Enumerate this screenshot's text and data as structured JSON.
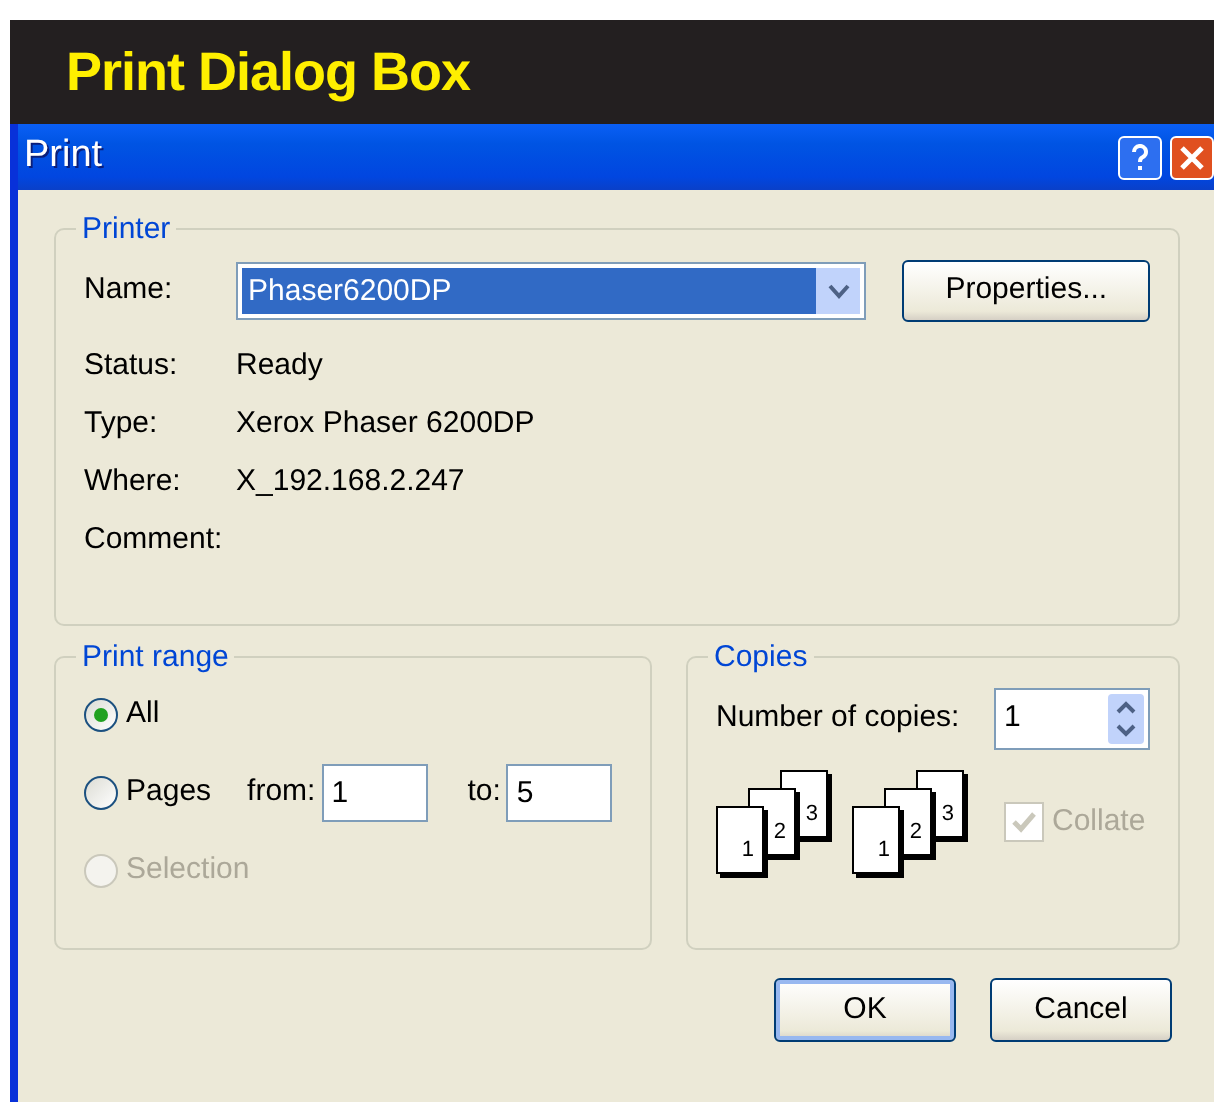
{
  "banner": {
    "title": "Print Dialog Box"
  },
  "window": {
    "title": "Print"
  },
  "printer": {
    "legend": "Printer",
    "name_label": "Name:",
    "name_value": "Phaser6200DP",
    "properties_button": "Properties...",
    "info": [
      {
        "label": "Status:",
        "value": "Ready"
      },
      {
        "label": "Type:",
        "value": "Xerox Phaser 6200DP"
      },
      {
        "label": "Where:",
        "value": "X_192.168.2.247"
      },
      {
        "label": "Comment:"
      }
    ]
  },
  "print_range": {
    "legend": "Print range",
    "options": [
      {
        "label": "All",
        "selected": true,
        "disabled": false
      },
      {
        "label": "Pages",
        "selected": false,
        "disabled": false,
        "from_label": "from:",
        "from_value": "1",
        "to_label": "to:",
        "to_value": "5"
      },
      {
        "label": "Selection",
        "selected": false,
        "disabled": true
      }
    ]
  },
  "copies": {
    "legend": "Copies",
    "count_label": "Number of copies:",
    "count_value": "1",
    "collate_stacks": [
      [
        "1",
        "2",
        "3"
      ],
      [
        "1",
        "2",
        "3"
      ]
    ],
    "collate": {
      "label": "Collate",
      "checked": true,
      "disabled": true
    }
  },
  "buttons": [
    {
      "label": "OK",
      "default": true
    },
    {
      "label": "Cancel",
      "default": false
    }
  ]
}
